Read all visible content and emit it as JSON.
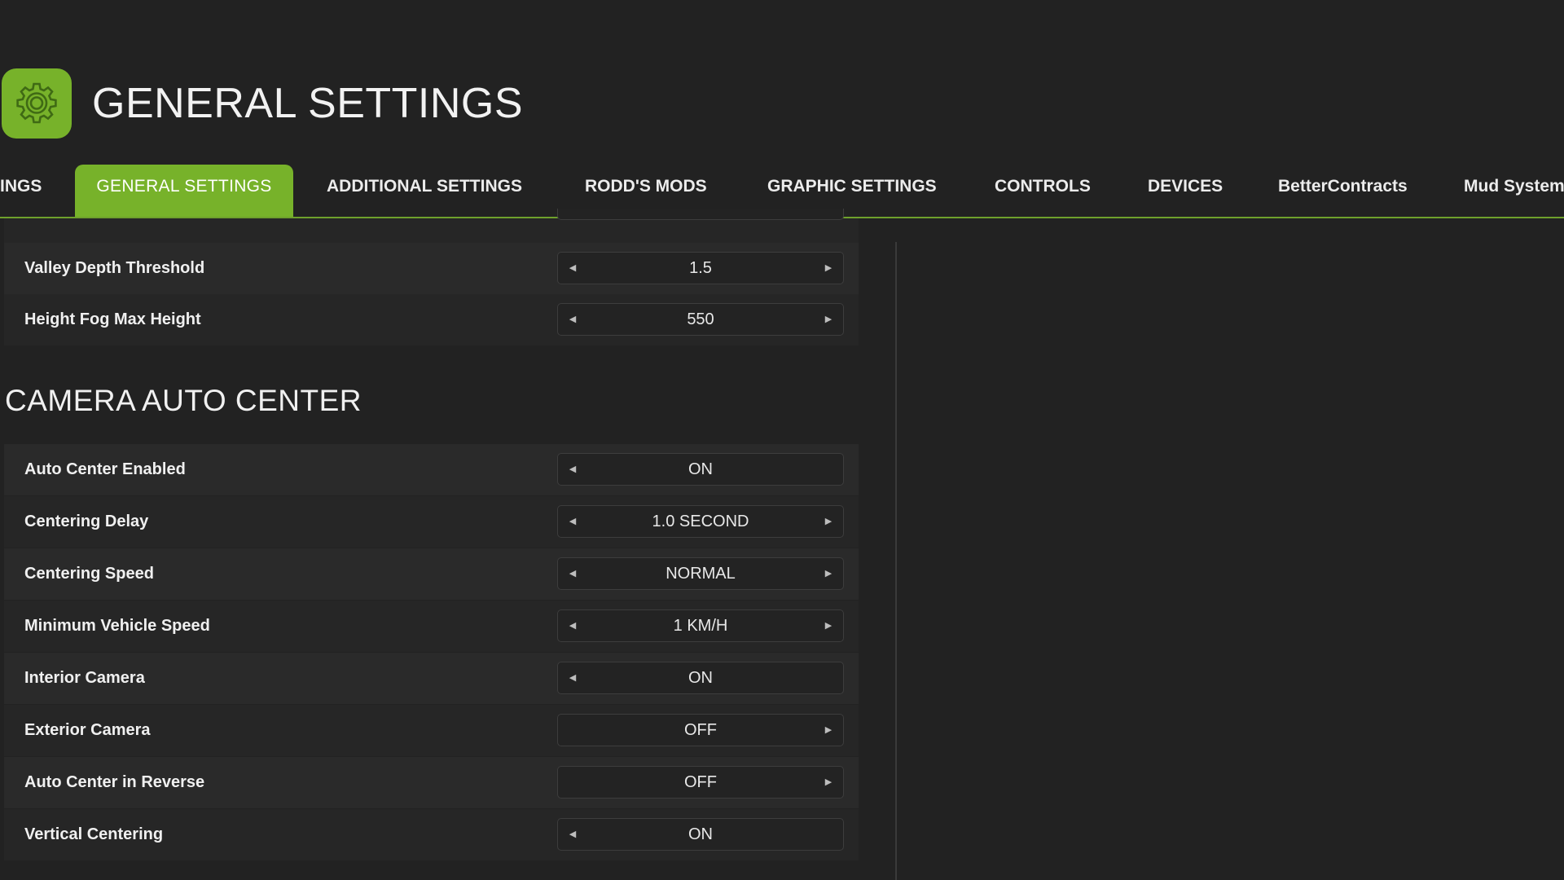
{
  "header": {
    "icon": "gear-icon",
    "title": "GENERAL SETTINGS"
  },
  "tabs": [
    {
      "label": "INGS",
      "active": false
    },
    {
      "label": "GENERAL SETTINGS",
      "active": true
    },
    {
      "label": "ADDITIONAL SETTINGS",
      "active": false
    },
    {
      "label": "RODD'S MODS",
      "active": false
    },
    {
      "label": "GRAPHIC SETTINGS",
      "active": false
    },
    {
      "label": "CONTROLS",
      "active": false
    },
    {
      "label": "DEVICES",
      "active": false
    },
    {
      "label": "BetterContracts",
      "active": false
    },
    {
      "label": "Mud System",
      "active": false
    }
  ],
  "top_rows": [
    {
      "label": "Valley Depth Threshold",
      "value": "1.5",
      "can_decrease": true,
      "can_increase": true
    },
    {
      "label": "Height Fog Max Height",
      "value": "550",
      "can_decrease": true,
      "can_increase": true
    }
  ],
  "section": {
    "title": "CAMERA AUTO CENTER"
  },
  "camera_rows": [
    {
      "label": "Auto Center Enabled",
      "value": "ON",
      "can_decrease": true,
      "can_increase": false
    },
    {
      "label": "Centering Delay",
      "value": "1.0 SECOND",
      "can_decrease": true,
      "can_increase": true
    },
    {
      "label": "Centering Speed",
      "value": "NORMAL",
      "can_decrease": true,
      "can_increase": true
    },
    {
      "label": "Minimum Vehicle Speed",
      "value": "1 KM/H",
      "can_decrease": true,
      "can_increase": true
    },
    {
      "label": "Interior Camera",
      "value": "ON",
      "can_decrease": true,
      "can_increase": false
    },
    {
      "label": "Exterior Camera",
      "value": "OFF",
      "can_decrease": false,
      "can_increase": true
    },
    {
      "label": "Auto Center in Reverse",
      "value": "OFF",
      "can_decrease": false,
      "can_increase": true
    },
    {
      "label": "Vertical Centering",
      "value": "ON",
      "can_decrease": true,
      "can_increase": false
    }
  ],
  "arrows": {
    "left_glyph": "◀",
    "right_glyph": "▶"
  },
  "colors": {
    "accent": "#77b22a",
    "background": "#222222",
    "row_odd": "#2a2a2a",
    "row_even": "#262626"
  }
}
